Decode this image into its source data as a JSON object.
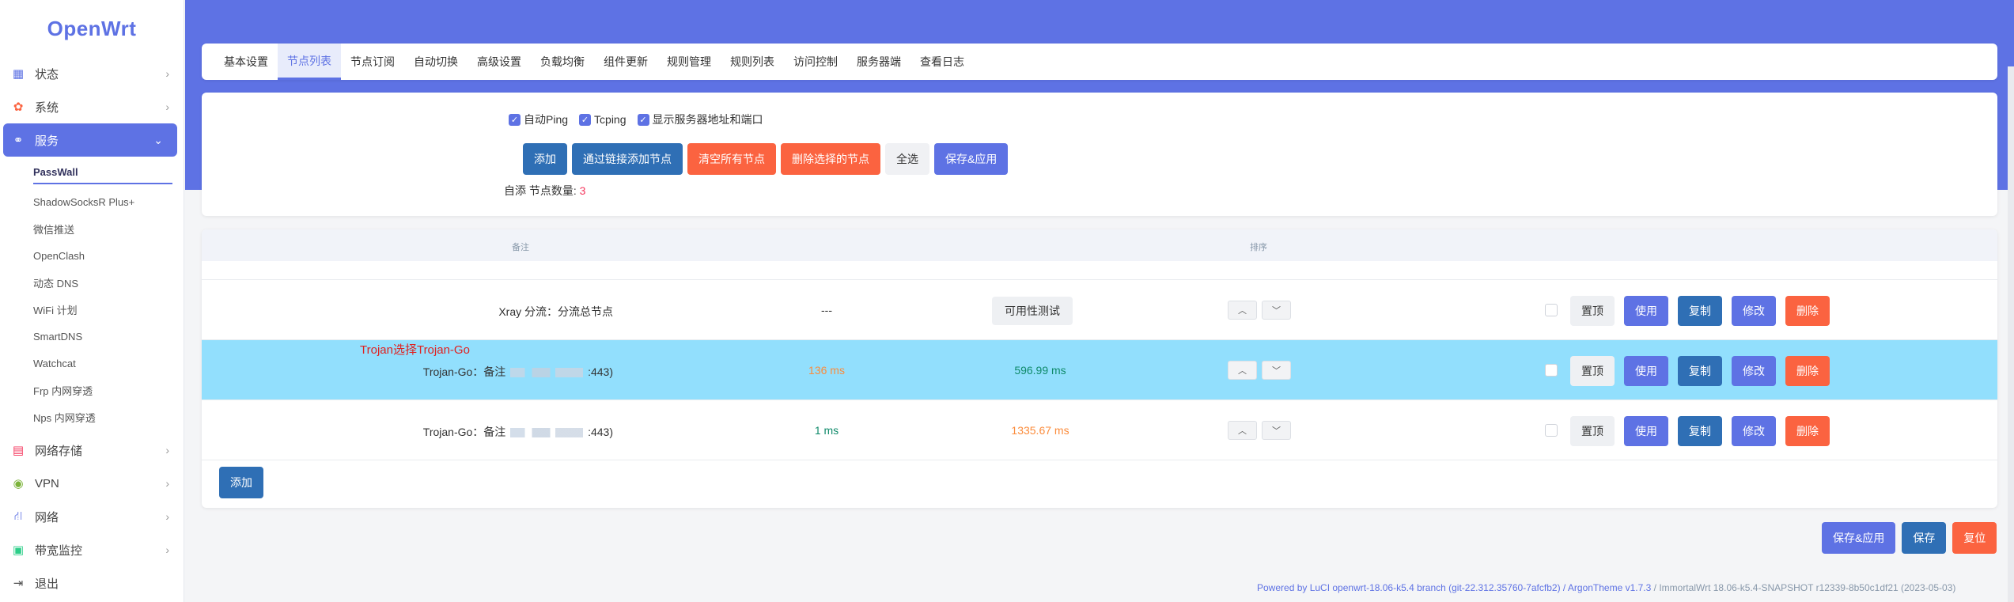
{
  "sidebar": {
    "logo": "OpenWrt",
    "items": [
      {
        "label": "状态",
        "icon": "dashboard-icon"
      },
      {
        "label": "系统",
        "icon": "gear-icon"
      },
      {
        "label": "服务",
        "icon": "link-icon"
      }
    ],
    "services_submenu": [
      "PassWall",
      "ShadowSocksR Plus+",
      "微信推送",
      "OpenClash",
      "动态 DNS",
      "WiFi 计划",
      "SmartDNS",
      "Watchcat",
      "Frp 内网穿透",
      "Nps 内网穿透"
    ],
    "items_after": [
      {
        "label": "网络存储",
        "icon": "storage-icon"
      },
      {
        "label": "VPN",
        "icon": "vpn-icon"
      },
      {
        "label": "网络",
        "icon": "network-icon"
      },
      {
        "label": "带宽监控",
        "icon": "monitor-icon"
      },
      {
        "label": "退出",
        "icon": "logout-icon"
      }
    ]
  },
  "tabs": [
    "基本设置",
    "节点列表",
    "节点订阅",
    "自动切换",
    "高级设置",
    "负载均衡",
    "组件更新",
    "规则管理",
    "规则列表",
    "访问控制",
    "服务器端",
    "查看日志"
  ],
  "active_tab": "节点列表",
  "options": {
    "auto_ping": "自动Ping",
    "tcping": "Tcping",
    "show_server": "显示服务器地址和端口"
  },
  "toolbar": {
    "add": "添加",
    "add_by_link": "通过链接添加节点",
    "clear_all": "清空所有节点",
    "delete_selected": "删除选择的节点",
    "select_all": "全选",
    "save_apply": "保存&应用"
  },
  "node_count": {
    "prefix": "自添 节点数量:",
    "value": "3"
  },
  "table": {
    "headers": {
      "remark": "备注",
      "sort": "排序"
    },
    "rows": [
      {
        "remark": "Xray 分流：分流总节点",
        "ping": "---",
        "tcping": "",
        "test_label": "可用性测试"
      },
      {
        "remark_prefix": "Trojan-Go：备注",
        "remark_suffix": ":443)",
        "ping": "136 ms",
        "tcping": "596.99 ms"
      },
      {
        "remark_prefix": "Trojan-Go：备注",
        "remark_suffix": ":443)",
        "ping": "1 ms",
        "tcping": "1335.67 ms"
      }
    ],
    "annotation": "Trojan选择Trojan-Go",
    "row_actions": {
      "top": "置顶",
      "use": "使用",
      "copy": "复制",
      "edit": "修改",
      "delete": "删除"
    },
    "add_label": "添加"
  },
  "bottom": {
    "save_apply": "保存&应用",
    "save": "保存",
    "reset": "复位"
  },
  "footer": {
    "powered": "Powered by LuCI openwrt-18.06-k5.4 branch (git-22.312.35760-7afcfb2) / ArgonTheme v1.7.3",
    "build": " / ImmortalWrt 18.06-k5.4-SNAPSHOT r12339-8b50c1df21 (2023-05-03)"
  },
  "colors": {
    "accent": "#5e72e4",
    "danger": "#fb6340",
    "primary_dark": "#2f6fb5",
    "highlight_row": "#92dffd"
  }
}
